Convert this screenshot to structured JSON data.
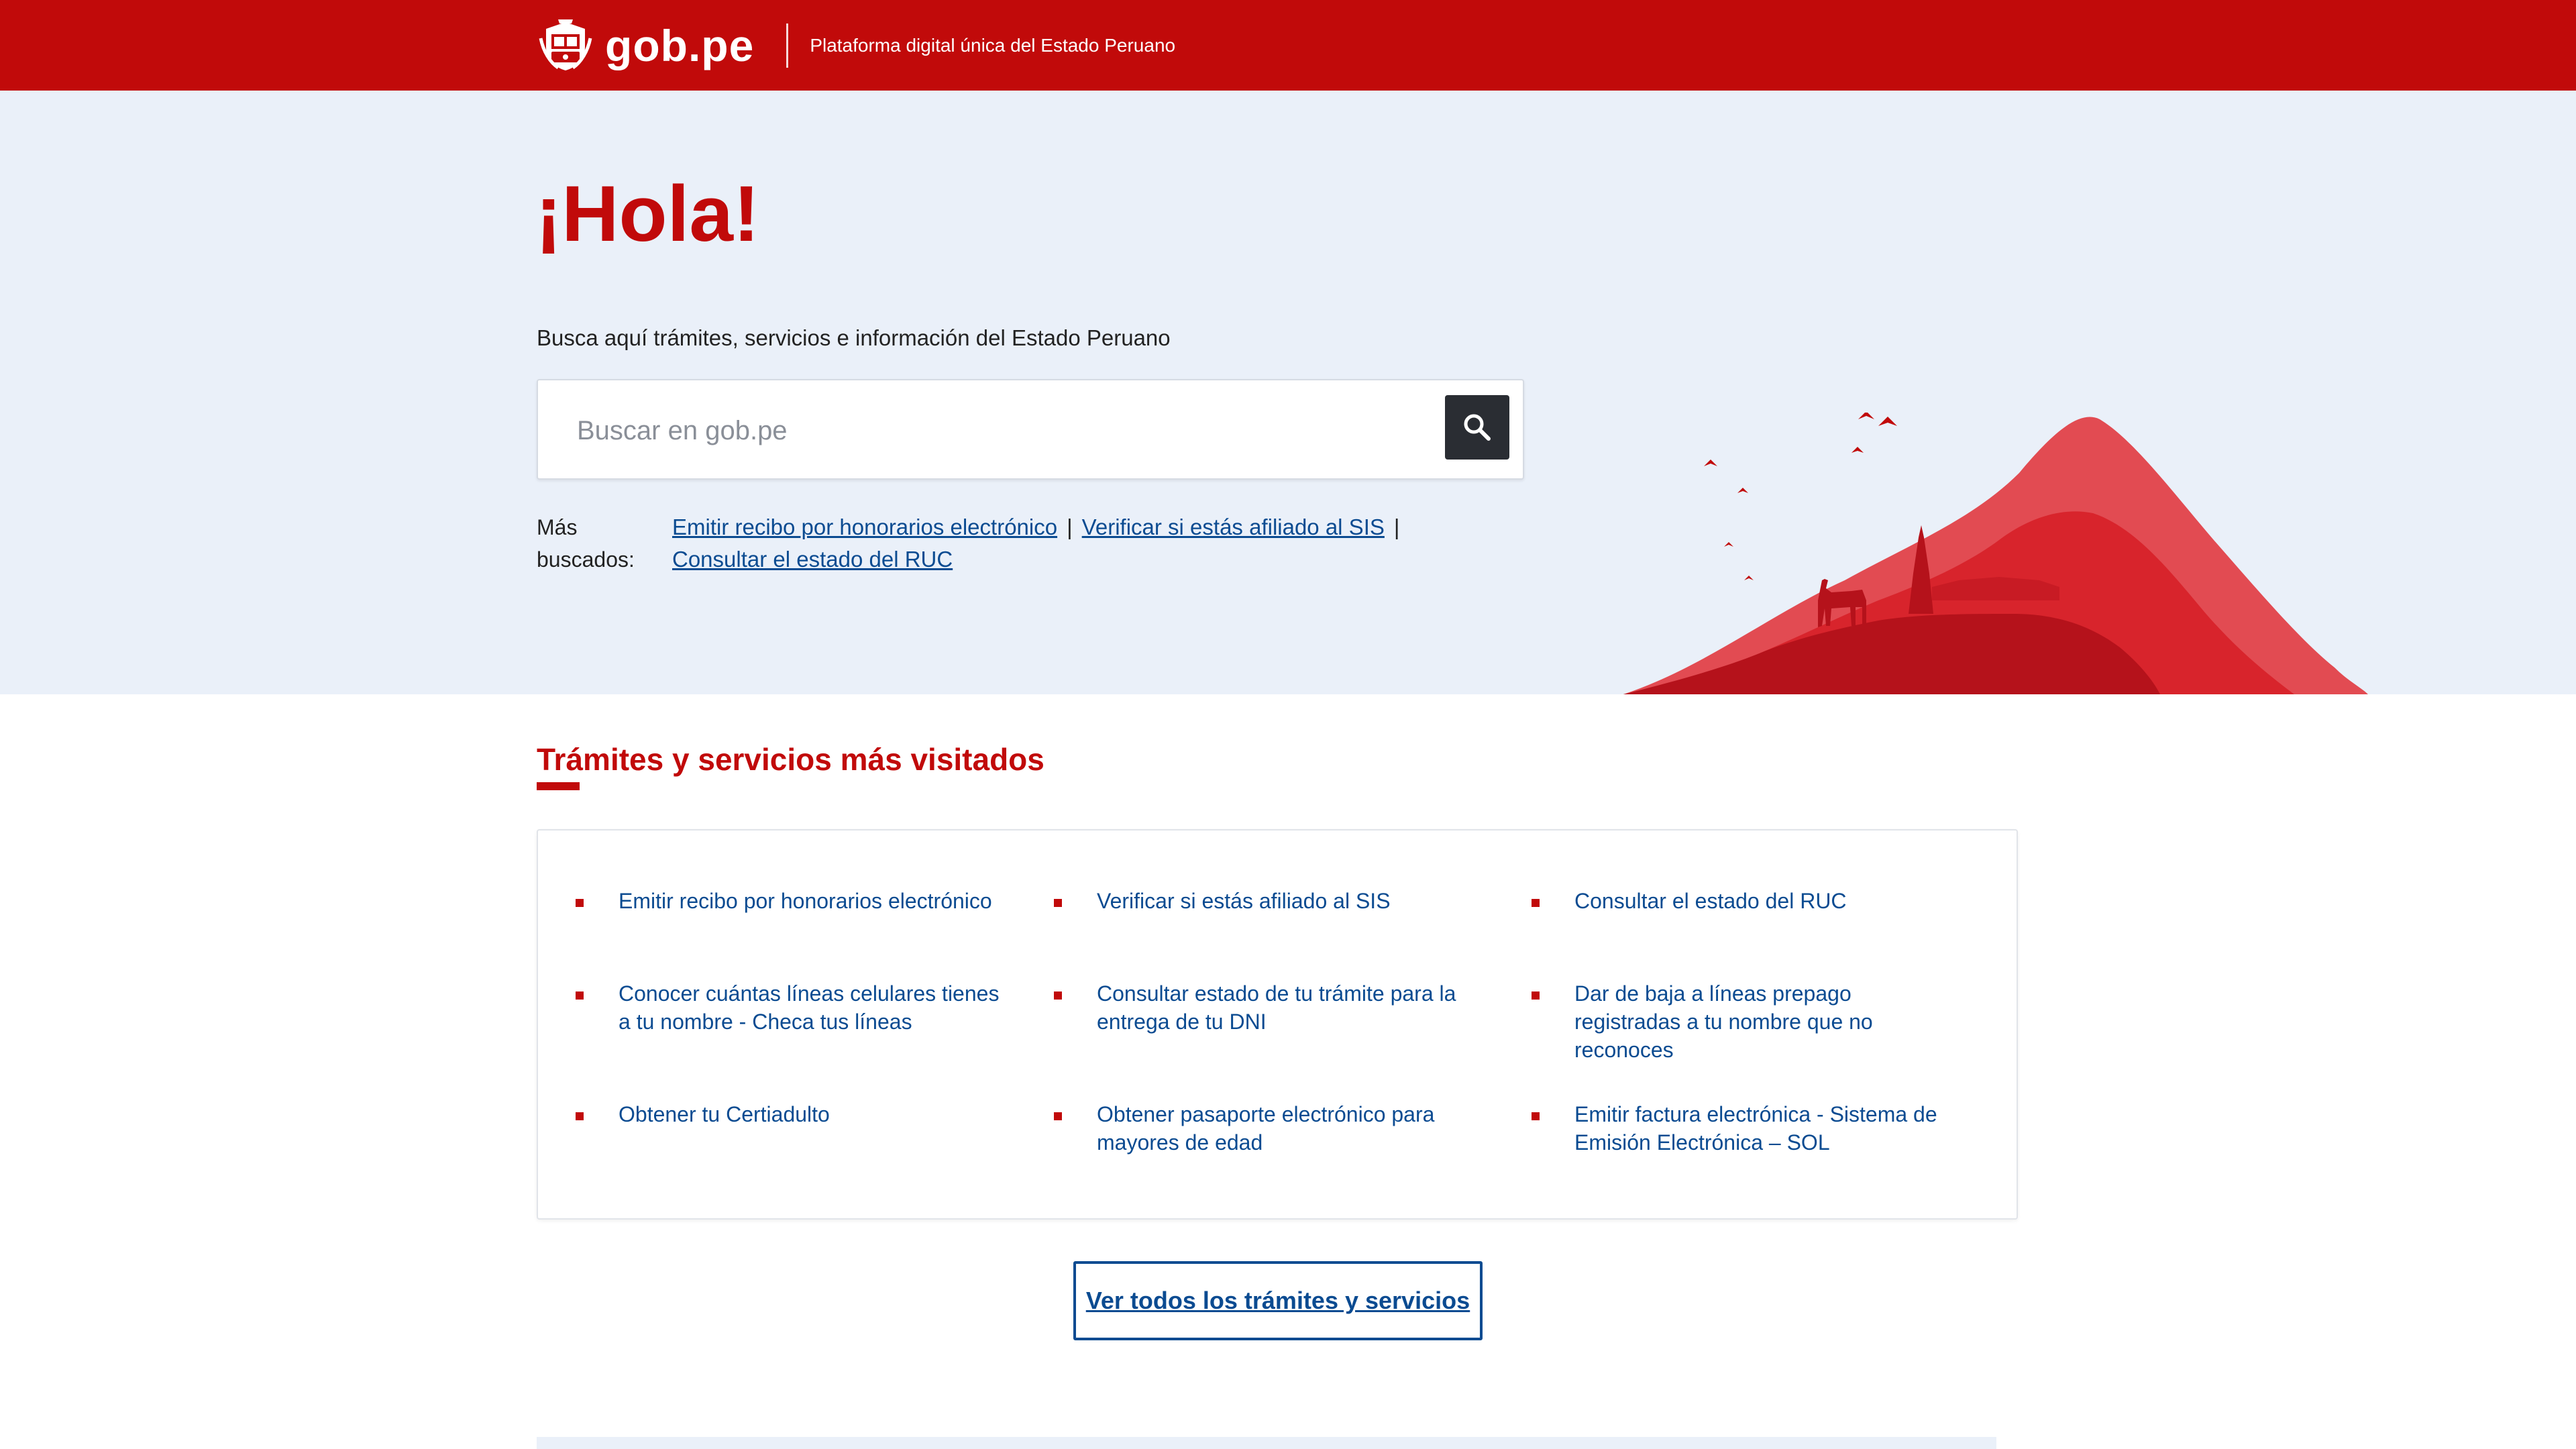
{
  "header": {
    "logo_text": "gob.pe",
    "tagline": "Plataforma digital única del Estado Peruano"
  },
  "hero": {
    "greeting": "¡Hola!",
    "lead": "Busca aquí trámites, servicios e información del Estado Peruano",
    "search_placeholder": "Buscar en gob.pe",
    "search_value": "",
    "popular_label": "Más buscados:",
    "popular_links": [
      "Emitir recibo por honorarios electrónico",
      "Verificar si estás afiliado al SIS",
      "Consultar el estado del RUC"
    ]
  },
  "services": {
    "title": "Trámites y servicios más visitados",
    "items": [
      "Emitir recibo por honorarios electrónico",
      "Verificar si estás afiliado al SIS",
      "Consultar el estado del RUC",
      "Conocer cuántas líneas celulares tienes a tu nombre - Checa tus líneas",
      "Consultar estado de tu trámite para la entrega de tu DNI",
      "Dar de baja a líneas prepago registradas a tu nombre que no reconoces",
      "Obtener tu Certiadulto",
      "Obtener pasaporte electrónico para mayores de edad",
      "Emitir factura electrónica - Sistema de Emisión Electrónica – SOL"
    ],
    "more_button": "Ver todos los trámites y servicios"
  },
  "colors": {
    "brand_red": "#c10a0a",
    "link_blue": "#0b4b91",
    "hero_bg": "#eaf0f9",
    "search_button": "#2a2d33"
  },
  "icons": {
    "logo": "peru-coat-of-arms-icon",
    "search": "search-icon",
    "illustration": "andes-mountain-vicuna-illustration"
  }
}
